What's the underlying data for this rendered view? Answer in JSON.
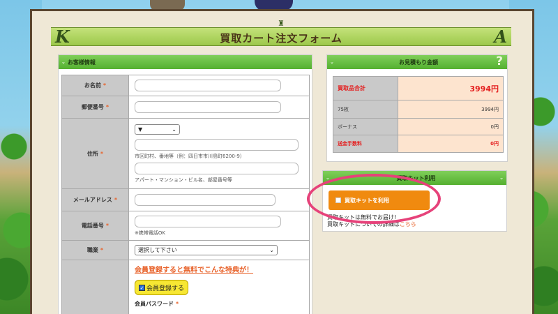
{
  "header": {
    "title": "買取カート注文フォーム",
    "letter_left": "K",
    "letter_right": "A"
  },
  "customer": {
    "section_title": "お客様情報",
    "fields": {
      "name": {
        "label": "お名前",
        "required": "*"
      },
      "postal": {
        "label": "郵便番号",
        "required": "*"
      },
      "address": {
        "label": "住所",
        "required": "*",
        "prefecture_value": "▼",
        "hint1": "市区町村、番地等（例：四日市市川島町6200-9）",
        "hint2": "アパート・マンション・ビル名、部屋番号等"
      },
      "email": {
        "label": "メールアドレス",
        "required": "*"
      },
      "phone": {
        "label": "電話番号",
        "required": "*",
        "hint": "※携帯電話OK"
      },
      "job": {
        "label": "職業",
        "required": "*",
        "select_value": "選択して下さい"
      }
    },
    "promo": {
      "title": "会員登録すると無料でこんな特典が！",
      "register_label": "会員登録する",
      "register_checked": true,
      "password_label": "会員パスワード",
      "password_required": "*"
    }
  },
  "estimate": {
    "section_title": "お見積もり金額",
    "help_icon": "?",
    "rows": [
      {
        "label": "買取品合計",
        "value": "3994円",
        "style": "total"
      },
      {
        "label": "75枚",
        "value": "3994円",
        "style": "normal"
      },
      {
        "label": "ボーナス",
        "value": "0円",
        "style": "normal"
      },
      {
        "label": "送金手数料",
        "value": "0円",
        "style": "fee"
      }
    ]
  },
  "kit": {
    "section_title": "買取キット利用",
    "button_label": "買取キットを利用",
    "note_line1": "買取キットは無料でお届け!",
    "note_line2_prefix": "買取キットについての詳細は",
    "note_link": "こちら"
  },
  "colors": {
    "section_green": "#55b030",
    "accent_orange": "#f08a0f",
    "required_orange": "#e8622a",
    "highlight_pink": "#e6427a",
    "price_red": "#e41e1e"
  }
}
